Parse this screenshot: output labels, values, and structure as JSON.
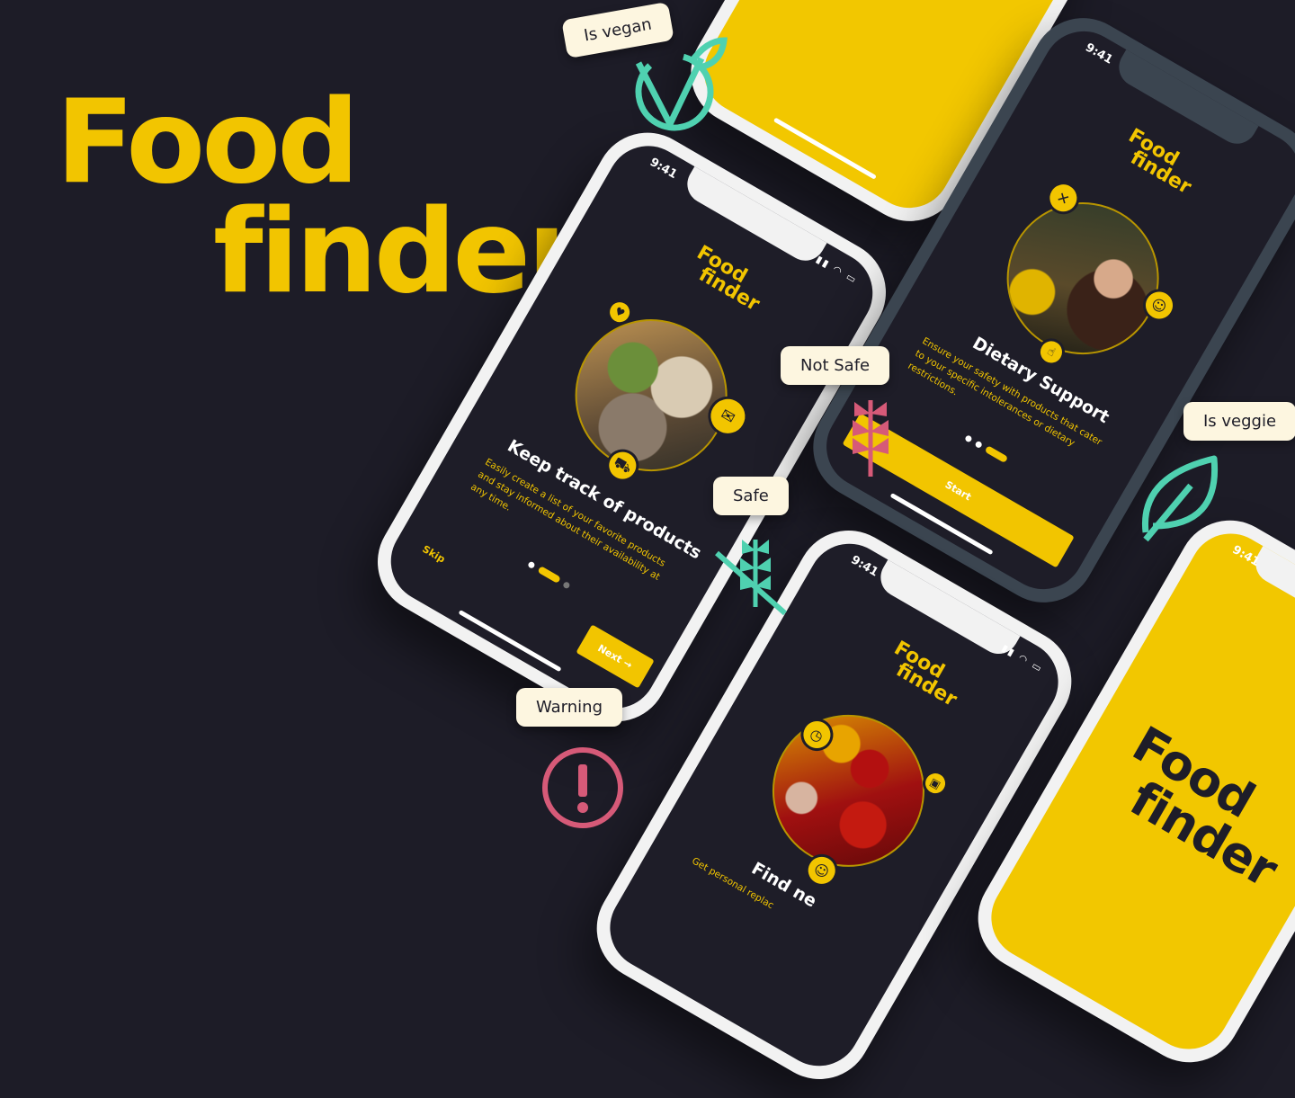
{
  "hero": {
    "line1": "Food",
    "line2": "finder"
  },
  "app": {
    "time": "9:41",
    "logo_line1": "Food",
    "logo_line2": "finder"
  },
  "screen_products": {
    "title": "Keep track of products",
    "description": "Easily create a list of your favorite products and stay informed about their availability at any time.",
    "skip_label": "Skip",
    "next_label": "Next →"
  },
  "screen_dietary": {
    "title": "Dietary Support",
    "description": "Ensure your safety with products that cater to your specific intolerances or dietary restrictions.",
    "start_label": "Start"
  },
  "screen_find": {
    "title": "Find ne",
    "description": "Get personal replac"
  },
  "tags": {
    "vegan": "Is vegan",
    "not_safe": "Not Safe",
    "veggie": "Is veggie",
    "safe": "Safe",
    "warning": "Warning"
  },
  "colors": {
    "background": "#1d1c27",
    "brand_yellow": "#f2c500",
    "mint": "#4fd1b0",
    "rose": "#d65a78",
    "tag_bg": "#fdf6e0"
  },
  "icons": [
    "vegan-icon",
    "wheat-icon",
    "leaf-icon",
    "gluten-free-icon",
    "warning-icon",
    "heart-icon",
    "chat-icon",
    "cart-icon",
    "no-wheat-icon",
    "person-icon",
    "hand-icon",
    "clock-icon",
    "jar-icon"
  ]
}
